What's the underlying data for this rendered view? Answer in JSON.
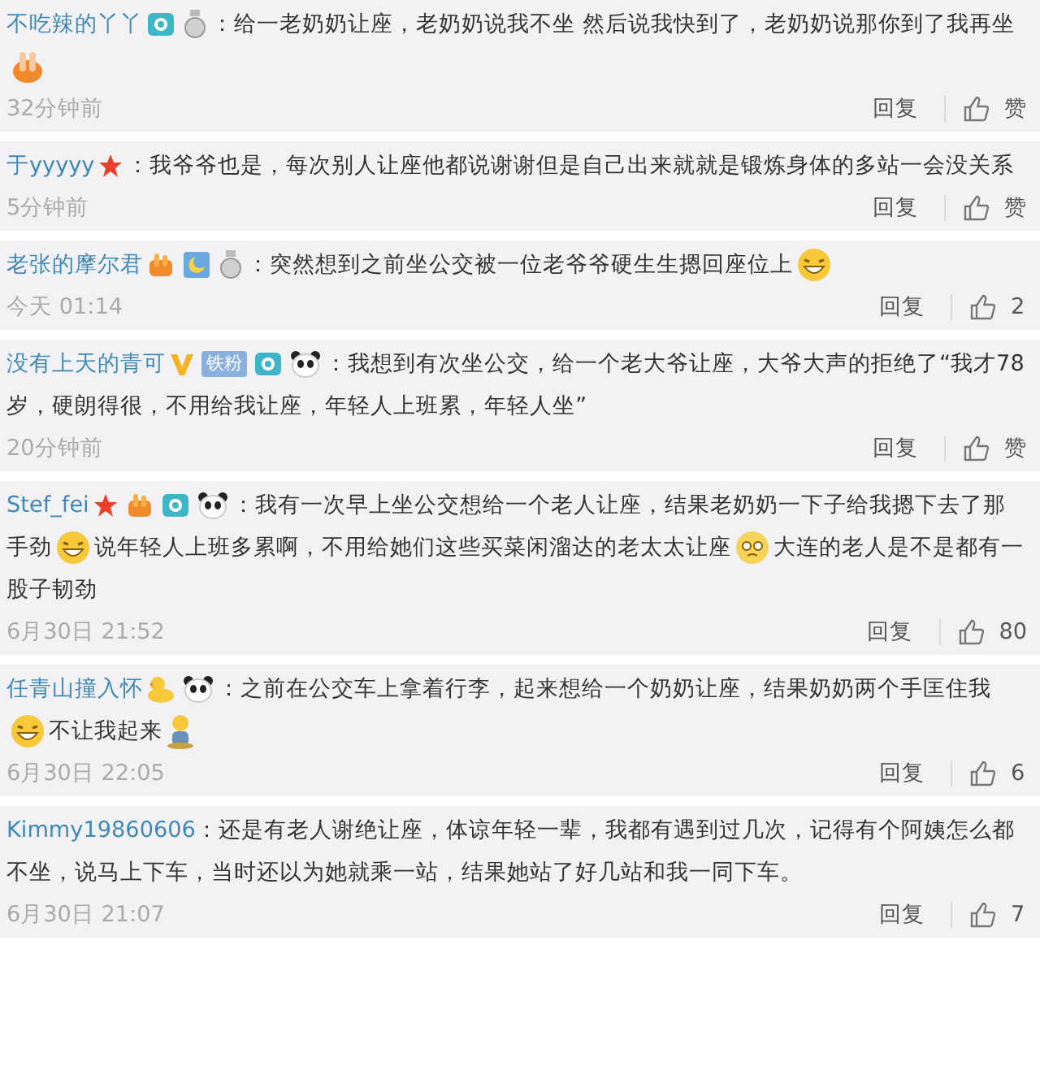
{
  "comments": [
    {
      "user": "不吃辣的丫丫",
      "badges": [
        {
          "kind": "camera"
        },
        {
          "kind": "medal"
        }
      ],
      "content": [
        {
          "kind": "text",
          "text": "：给一老奶奶让座，老奶奶说我不坐 然后说我快到了，老奶奶说那你到了我再坐"
        },
        {
          "kind": "hands"
        }
      ],
      "time": "32分钟前",
      "reply": "回复",
      "likes": "赞"
    },
    {
      "user": "于yyyyy",
      "badges": [
        {
          "kind": "star"
        }
      ],
      "content": [
        {
          "kind": "text",
          "text": "：我爷爷也是，每次别人让座他都说谢谢但是自己出来就就是锻炼身体的多站一会没关系"
        }
      ],
      "time": "5分钟前",
      "reply": "回复",
      "likes": "赞"
    },
    {
      "user": "老张的摩尔君",
      "badges": [
        {
          "kind": "flame"
        },
        {
          "kind": "moon"
        },
        {
          "kind": "medal"
        }
      ],
      "content": [
        {
          "kind": "text",
          "text": "：突然想到之前坐公交被一位老爷爷硬生生摁回座位上"
        },
        {
          "kind": "laugh"
        }
      ],
      "time": "今天 01:14",
      "reply": "回复",
      "likes": "2"
    },
    {
      "user": "没有上天的青可",
      "badges": [
        {
          "kind": "vip"
        },
        {
          "kind": "tag",
          "label": "铁粉"
        },
        {
          "kind": "camera"
        },
        {
          "kind": "panda"
        }
      ],
      "content": [
        {
          "kind": "text",
          "text": "：我想到有次坐公交，给一个老大爷让座，大爷大声的拒绝了“我才78岁，硬朗得很，不用给我让座，年轻人上班累，年轻人坐”"
        }
      ],
      "time": "20分钟前",
      "reply": "回复",
      "likes": "赞"
    },
    {
      "user": "Stef_fei",
      "badges": [
        {
          "kind": "star"
        },
        {
          "kind": "flame"
        },
        {
          "kind": "camera"
        },
        {
          "kind": "panda"
        }
      ],
      "content": [
        {
          "kind": "text",
          "text": "：我有一次早上坐公交想给一个老人让座，结果老奶奶一下子给我摁下去了那手劲"
        },
        {
          "kind": "laugh"
        },
        {
          "kind": "text",
          "text": "说年轻人上班多累啊，不用给她们这些买菜闲溜达的老太太让座"
        },
        {
          "kind": "sad"
        },
        {
          "kind": "text",
          "text": "大连的老人是不是都有一股子韧劲"
        }
      ],
      "time": "6月30日 21:52",
      "reply": "回复",
      "likes": "80"
    },
    {
      "user": "任青山撞入怀",
      "badges": [
        {
          "kind": "duck"
        },
        {
          "kind": "panda"
        }
      ],
      "content": [
        {
          "kind": "text",
          "text": "：之前在公交车上拿着行李，起来想给一个奶奶让座，结果奶奶两个手匡住我"
        },
        {
          "kind": "laugh"
        },
        {
          "kind": "text",
          "text": "不让我起来"
        },
        {
          "kind": "figure"
        }
      ],
      "time": "6月30日 22:05",
      "reply": "回复",
      "likes": "6"
    },
    {
      "user": "Kimmy19860606",
      "content": [
        {
          "kind": "text",
          "text": "：还是有老人谢绝让座，体谅年轻一辈，我都有遇到过几次，记得有个阿姨怎么都不坐，说马上下车，当时还以为她就乘一站，结果她站了好几站和我一同下车。"
        }
      ],
      "time": "6月30日 21:07",
      "reply": "回复",
      "likes": "7"
    }
  ]
}
